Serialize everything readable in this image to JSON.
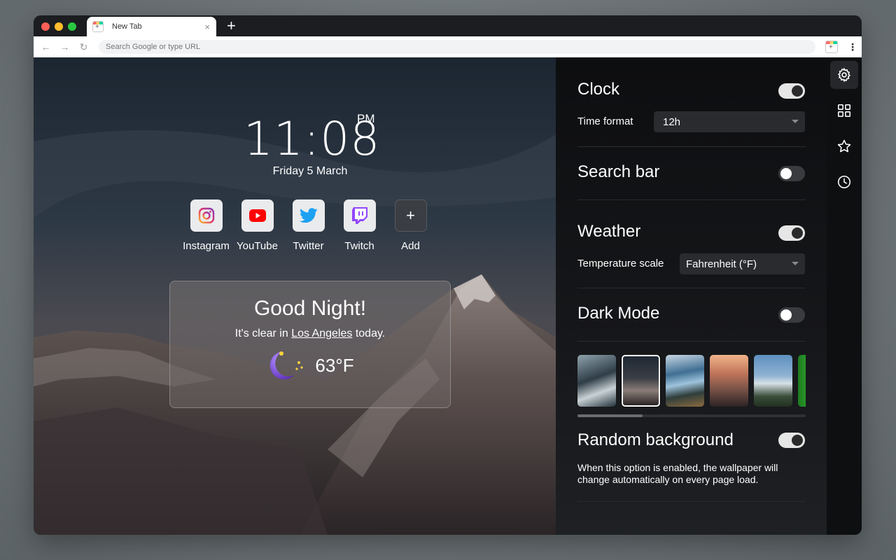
{
  "browser": {
    "tab_title": "New Tab",
    "tab_close": "×",
    "new_tab": "+",
    "address_placeholder": "Search Google or type URL",
    "back_icon": "←",
    "forward_icon": "→",
    "reload_icon": "↻",
    "menu_icon": "⋮"
  },
  "clock": {
    "time": "11:08",
    "ampm": "PM",
    "date": "Friday 5 March"
  },
  "shortcuts": [
    {
      "label": "Instagram",
      "icon": "instagram-icon"
    },
    {
      "label": "YouTube",
      "icon": "youtube-icon"
    },
    {
      "label": "Twitter",
      "icon": "twitter-icon"
    },
    {
      "label": "Twitch",
      "icon": "twitch-icon"
    },
    {
      "label": "Add",
      "icon": "plus-icon"
    }
  ],
  "add_glyph": "+",
  "weather": {
    "greeting": "Good Night!",
    "text_before": "It's clear in ",
    "city": "Los Angeles",
    "text_after": " today.",
    "temperature": "63°F",
    "icon": "moon-stars-icon"
  },
  "settings": {
    "clock": {
      "title": "Clock",
      "enabled": true,
      "format_label": "Time format",
      "format_value": "12h"
    },
    "search_bar": {
      "title": "Search bar",
      "enabled": false
    },
    "weather": {
      "title": "Weather",
      "enabled": true,
      "scale_label": "Temperature scale",
      "scale_value": "Fahrenheit (°F)"
    },
    "dark_mode": {
      "title": "Dark Mode",
      "enabled": false
    },
    "random_background": {
      "title": "Random background",
      "enabled": true,
      "description": "When this option is enabled, the wallpaper will change automatically on every page load."
    },
    "wallpapers_selected_index": 1
  },
  "rail": [
    "gear-icon",
    "grid-icon",
    "star-icon",
    "clock-icon"
  ],
  "colors": {
    "instagram": "#e1306c",
    "youtube": "#ff0000",
    "twitter": "#1da1f2",
    "twitch": "#9146ff",
    "moon": "#7b4bd6"
  }
}
